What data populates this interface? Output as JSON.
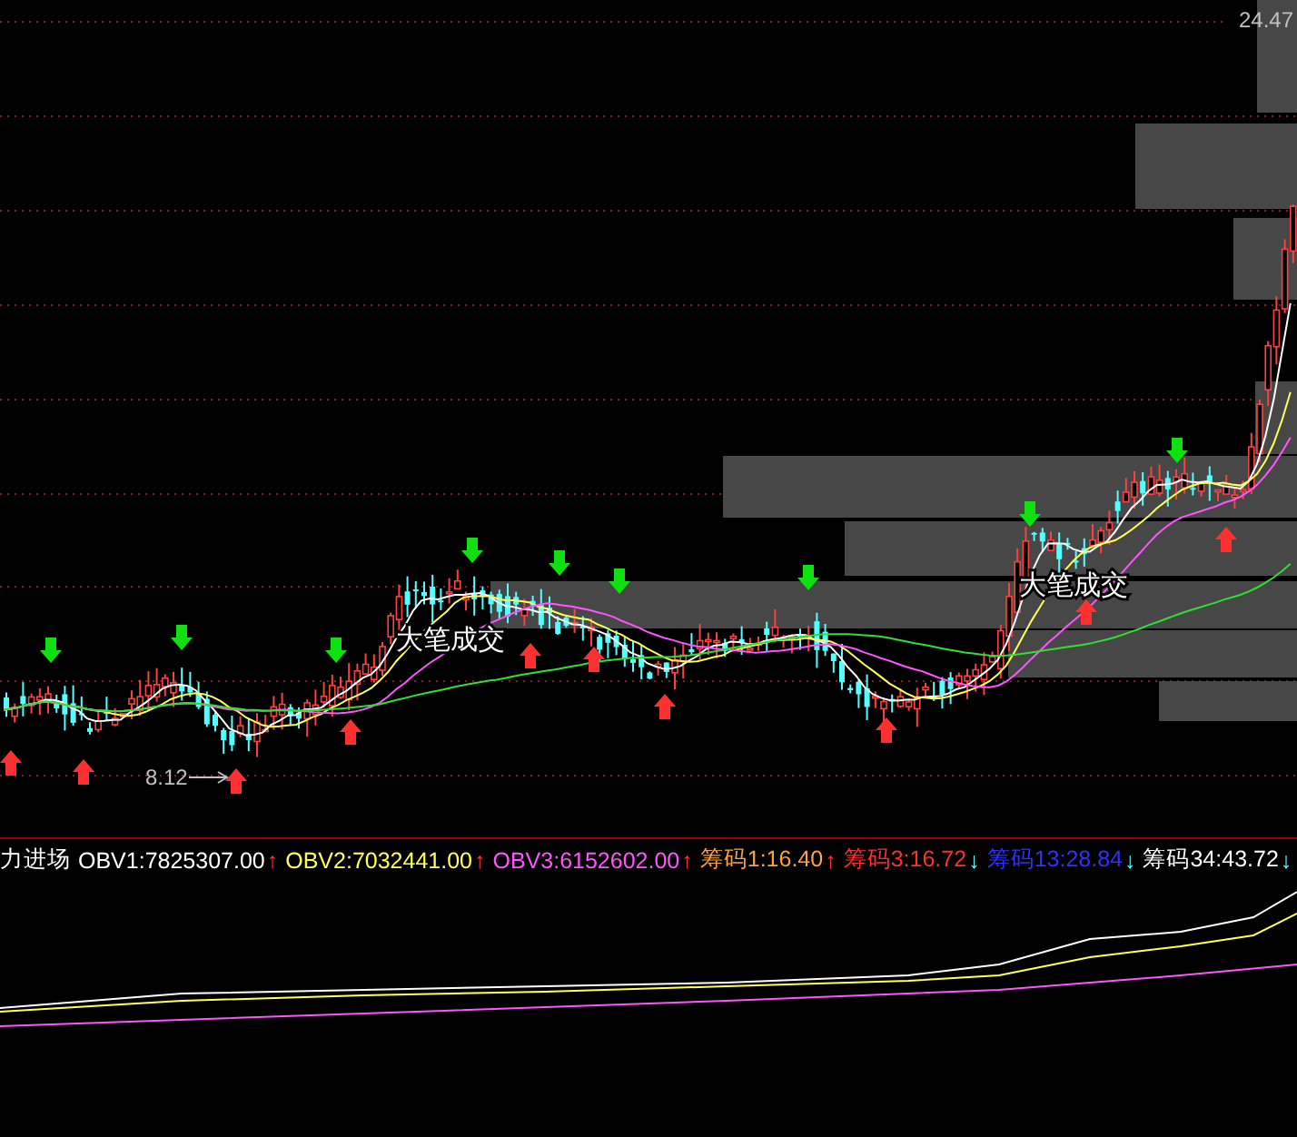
{
  "price_axis": {
    "top_label": "24.47",
    "low_label": "8.12"
  },
  "annotations": [
    {
      "text": "大笔成交"
    },
    {
      "text": "大笔成交"
    }
  ],
  "legend": {
    "title": "力进场",
    "items": [
      {
        "kind": "rising",
        "label": "OBV1:7825307.00",
        "color": "#ffffff",
        "arrow": "↑"
      },
      {
        "kind": "rising",
        "label": "OBV2:7032441.00",
        "color": "#ffff54",
        "arrow": "↑"
      },
      {
        "kind": "rising",
        "label": "OBV3:6152602.00",
        "color": "#ff54ff",
        "arrow": "↑"
      },
      {
        "kind": "rising",
        "label": "筹码1:16.40",
        "color": "#ffa040",
        "arrow": "↑"
      },
      {
        "kind": "falling",
        "label": "筹码3:16.72",
        "color": "#ff3030",
        "arrow": "↓"
      },
      {
        "kind": "falling",
        "label": "筹码13:28.84",
        "color": "#3030ff",
        "arrow": "↓"
      },
      {
        "kind": "falling",
        "label": "筹码34:43.72",
        "color": "#ffffff",
        "arrow": "↓"
      }
    ]
  }
}
